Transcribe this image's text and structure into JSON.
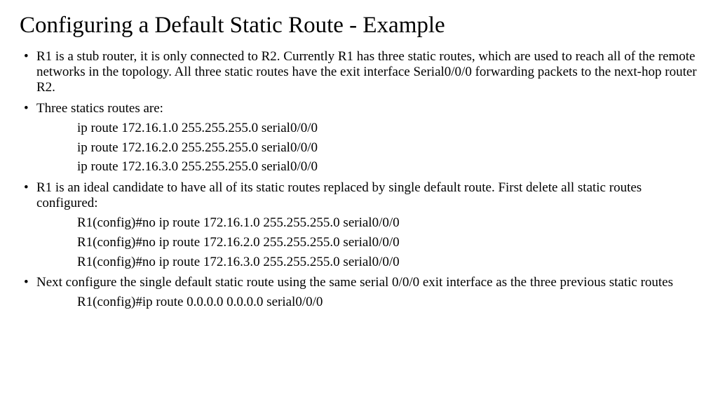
{
  "title": "Configuring a Default Static Route - Example",
  "bullets": {
    "b1": "R1 is a stub router, it is only connected to R2. Currently R1 has three static routes, which are used to reach all of the remote networks in the topology. All three static routes have the exit interface Serial0/0/0 forwarding packets to the next-hop router R2.",
    "b2": "Three statics routes are:",
    "routes1": {
      "r1": "ip route 172.16.1.0 255.255.255.0 serial0/0/0",
      "r2": "ip route 172.16.2.0 255.255.255.0 serial0/0/0",
      "r3": "ip route 172.16.3.0 255.255.255.0 serial0/0/0"
    },
    "b3": "R1 is an ideal candidate to have all of its static routes replaced by single default route. First delete all static routes configured:",
    "routes2": {
      "r1": "R1(config)#no ip route 172.16.1.0 255.255.255.0 serial0/0/0",
      "r2": "R1(config)#no ip route 172.16.2.0 255.255.255.0 serial0/0/0",
      "r3": "R1(config)#no ip route 172.16.3.0 255.255.255.0 serial0/0/0"
    },
    "b4": "Next configure the single default static route using the same serial 0/0/0 exit interface as the three previous static routes",
    "routes3": {
      "r1": "R1(config)#ip route 0.0.0.0 0.0.0.0 serial0/0/0"
    }
  }
}
